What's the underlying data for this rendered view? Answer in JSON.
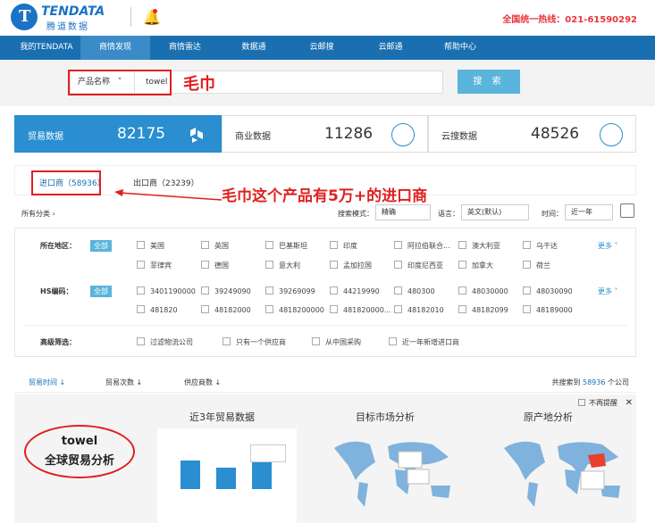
{
  "header": {
    "logo_text": "TENDATA",
    "logo_cn": "腾道数据",
    "hotline": "全国统一热线：021-61590292"
  },
  "nav": [
    "我的TENDATA",
    "商情发现",
    "商情雷达",
    "数据通",
    "云邮搜",
    "云邮通",
    "帮助中心"
  ],
  "search": {
    "field": "产品名称",
    "value": "towel",
    "annotation": "毛巾",
    "button": "搜 索"
  },
  "stats": [
    {
      "label": "贸易数据",
      "value": "82175"
    },
    {
      "label": "商业数据",
      "value": "11286"
    },
    {
      "label": "云搜数据",
      "value": "48526"
    }
  ],
  "tabs": [
    {
      "label": "进口商（58936）"
    },
    {
      "label": "出口商（23239）"
    }
  ],
  "annotation2": "毛巾这个产品有5万+的进口商",
  "filters": {
    "all_categories": "所有分类",
    "mode_label": "搜索模式：",
    "mode": "精确",
    "lang_label": "语言：",
    "lang": "英文(默认)",
    "time_label": "时间：",
    "time": "近一年"
  },
  "region": {
    "label": "所在地区：",
    "all": "全部",
    "items": [
      "美国",
      "英国",
      "巴基斯坦",
      "印度",
      "阿拉伯联合...",
      "澳大利亚",
      "乌干达",
      "菲律宾",
      "德国",
      "意大利",
      "孟加拉国",
      "印度尼西亚",
      "加拿大",
      "荷兰"
    ],
    "more": "更多"
  },
  "hs": {
    "label": "HS编码：",
    "all": "全部",
    "items": [
      "3401190000",
      "39249090",
      "39269099",
      "44219990",
      "480300",
      "48030000",
      "48030090",
      "481820",
      "48182000",
      "4818200000",
      "481820000...",
      "48182010",
      "48182099",
      "48189000"
    ],
    "more": "更多"
  },
  "advanced": {
    "label": "高级筛选：",
    "items": [
      "过滤物流公司",
      "只有一个供应商",
      "从中国采购",
      "近一年新增进口商"
    ]
  },
  "sort": {
    "items": [
      "贸易时间",
      "贸易次数",
      "供应商数"
    ],
    "total_prefix": "共搜索到",
    "total": "58936",
    "total_suffix": "个公司"
  },
  "analysis": {
    "no_remind": "不再提醒",
    "titles": [
      "近3年贸易数据",
      "目标市场分析",
      "原产地分析"
    ],
    "ellipse_line1": "towel",
    "ellipse_line2": "全球贸易分析"
  },
  "colors": {
    "nav": "#1a6fb1",
    "accent": "#2a8ed0",
    "annotation": "#e02020",
    "hotline": "#e8353a"
  }
}
